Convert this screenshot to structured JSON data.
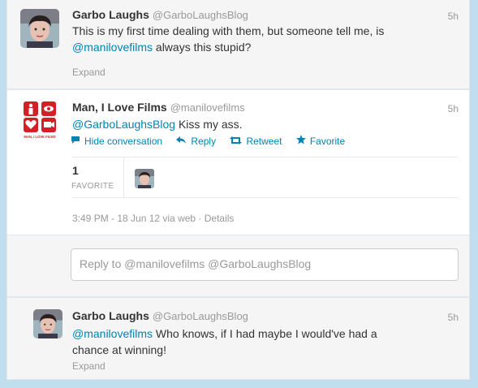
{
  "tweet1": {
    "name": "Garbo Laughs",
    "handle": "@GarboLaughsBlog",
    "time": "5h",
    "text_before": "This is my first time dealing with them, but someone tell me, is ",
    "mention": "@manilovefilms",
    "text_after": " always this stupid?",
    "expand": "Expand",
    "avatar_icon": "user-avatar"
  },
  "tweet2": {
    "name": "Man, I Love Films",
    "handle": "@manilovefilms",
    "time": "5h",
    "mention": "@GarboLaughsBlog",
    "text_after": " Kiss my ass.",
    "actions": {
      "hide": "Hide conversation",
      "reply": "Reply",
      "retweet": "Retweet",
      "favorite": "Favorite"
    },
    "favorites_count": "1",
    "favorites_label": "FAVORITE",
    "meta": "3:49 PM - 18 Jun 12 via web · Details",
    "logo_text": "MAN, I LOVE FILMS",
    "brand_color": "#d32027"
  },
  "reply_box": {
    "placeholder": "Reply to @manilovefilms @GarboLaughsBlog"
  },
  "tweet3": {
    "name": "Garbo Laughs",
    "handle": "@GarboLaughsBlog",
    "time": "5h",
    "mention": "@manilovefilms",
    "text_after": " Who knows, if I had maybe I would've had a chance at winning!",
    "expand": "Expand"
  },
  "colors": {
    "link": "#0084b4",
    "background": "#c0deed"
  }
}
